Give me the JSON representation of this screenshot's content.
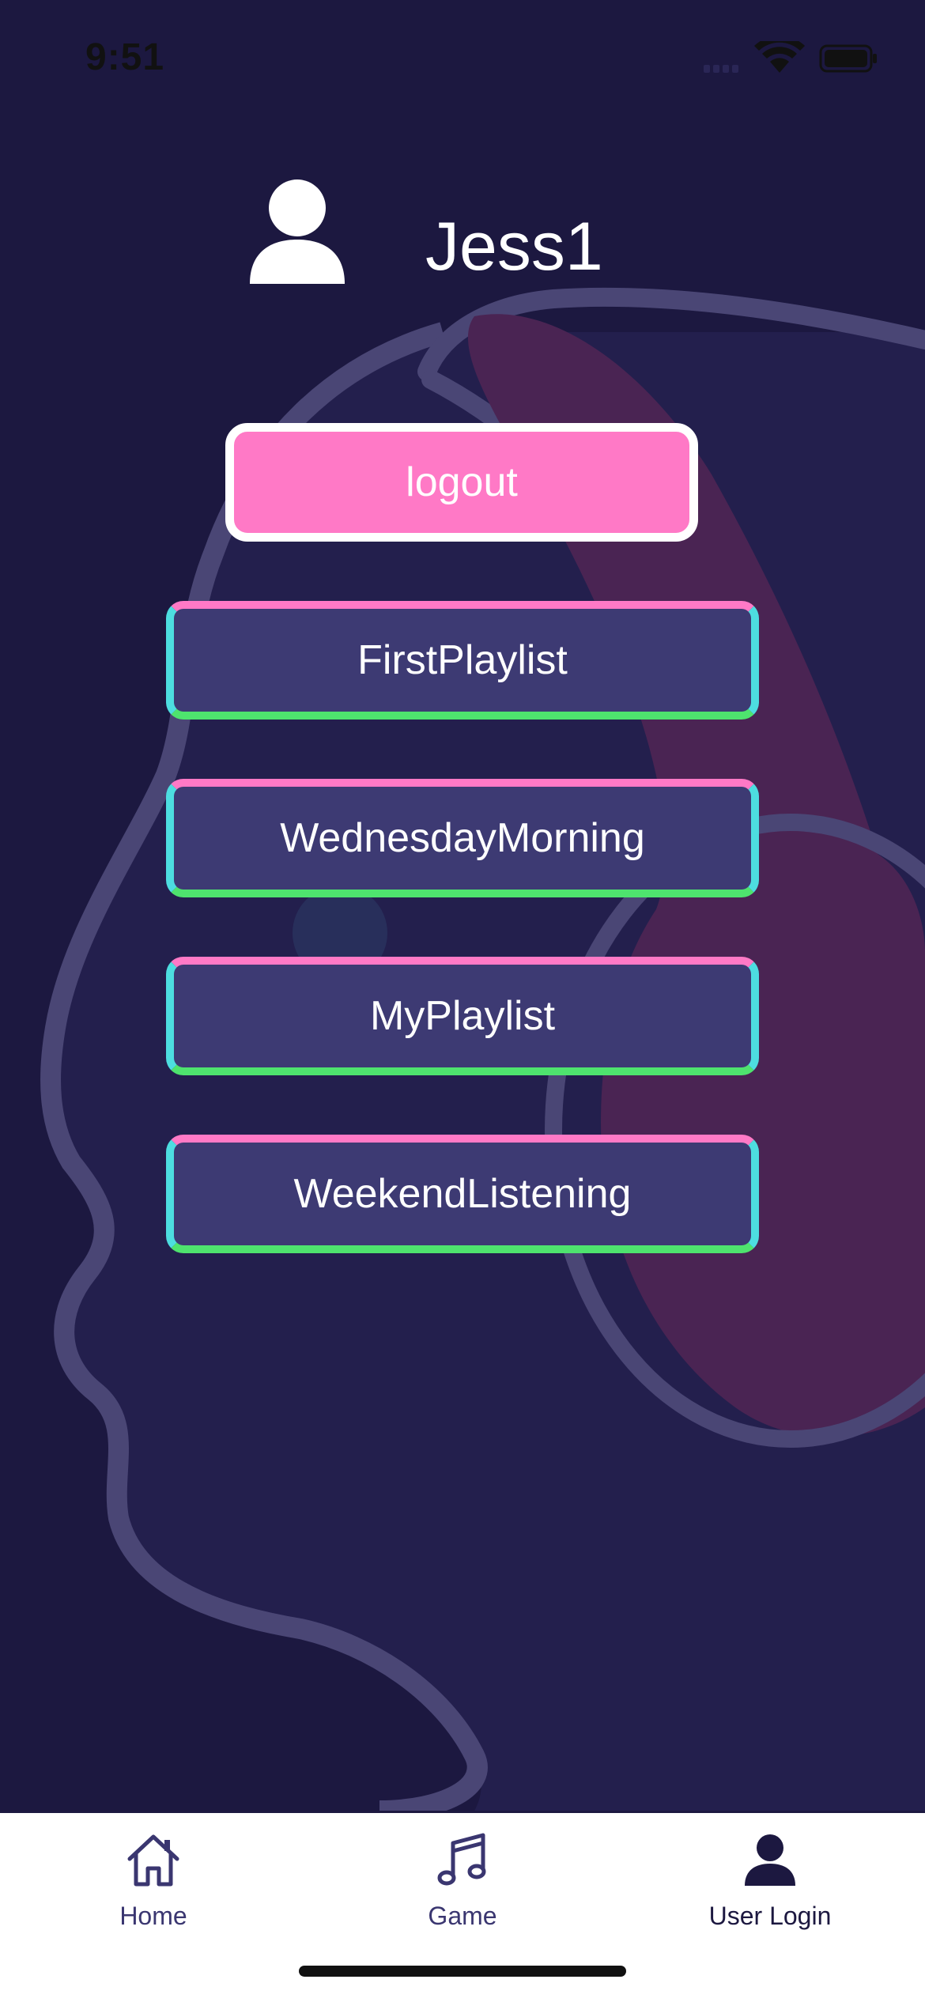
{
  "status_bar": {
    "time": "9:51",
    "icons": [
      "signal-icon",
      "wifi-icon",
      "battery-icon"
    ]
  },
  "profile": {
    "username": "Jess1",
    "avatar_icon": "user-icon"
  },
  "logout": {
    "label": "logout"
  },
  "playlists": [
    {
      "label": "FirstPlaylist"
    },
    {
      "label": "WednesdayMorning"
    },
    {
      "label": "MyPlaylist"
    },
    {
      "label": "WeekendListening"
    }
  ],
  "tab_bar": {
    "tabs": [
      {
        "label": "Home",
        "icon": "home-icon"
      },
      {
        "label": "Game",
        "icon": "music-note-icon"
      },
      {
        "label": "User Login",
        "icon": "user-icon",
        "active": true
      }
    ]
  },
  "colors": {
    "background": "#1c1840",
    "accent_pink": "#ff79c6",
    "accent_cyan": "#4ddde0",
    "accent_green": "#4ee36e",
    "button_fill": "#3d3a73"
  }
}
